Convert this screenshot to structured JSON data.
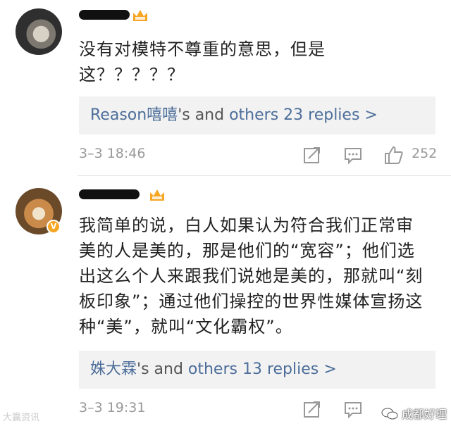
{
  "comments": [
    {
      "username": "",
      "content_lines": [
        "没有对模特不尊重的意思，但是",
        "这？？？？？"
      ],
      "replies": {
        "name": "Reason嘻嘻",
        "middle": "'s and ",
        "others": "others 23 replies >"
      },
      "timestamp": "3–3 18:46",
      "likes": "252"
    },
    {
      "username": "",
      "content_lines": [
        "我简单的说，白人如果认为符合我们正常审",
        "美的人是美的，那是他们的“宽容”；他们选",
        "出这么个人来跟我们说她是美的，那就叫“刻",
        "板印象”；通过他们操控的世界性媒体宣扬这",
        "种“美”，就叫“文化霸权”。"
      ],
      "replies": {
        "name": "姝大霖",
        "middle": "'s and ",
        "others": "others 13 replies >"
      },
      "timestamp": "3–3 19:31",
      "likes": ""
    }
  ],
  "icons": {
    "vip": "crown-vip-icon",
    "share": "share-icon",
    "comment": "comment-icon",
    "like": "thumbs-up-icon",
    "verified": "verified-badge-icon"
  },
  "watermark": {
    "left": "大赢资讯",
    "right": "成都好理"
  },
  "colors": {
    "username": "#e8731f",
    "link": "#4d6e9a",
    "meta": "#999999",
    "reply_bg": "#f2f2f2",
    "vip": "#f6a623"
  }
}
